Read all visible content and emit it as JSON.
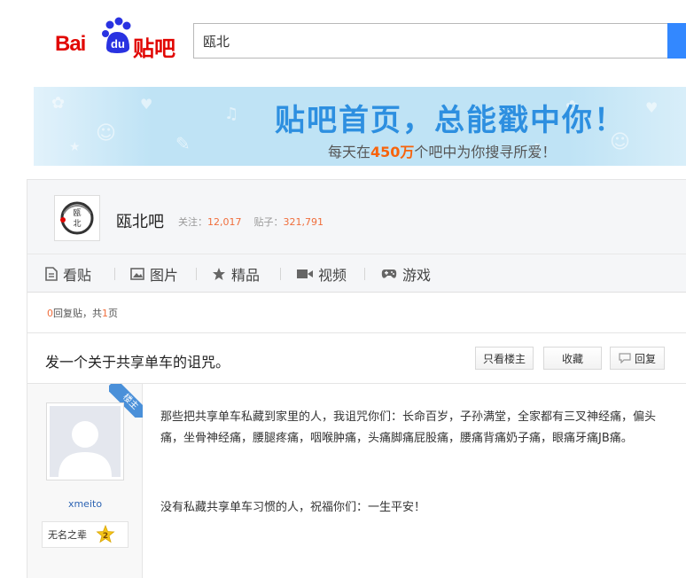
{
  "header": {
    "logo_text_bai": "Bai",
    "logo_text_du": "du",
    "logo_text_tieba": "贴吧",
    "search_value": "瓯北"
  },
  "banner": {
    "title": "贴吧首页，总能戳中你！",
    "sub_prefix": "每天在",
    "sub_number": "450万",
    "sub_suffix": "个吧中为你搜寻所爱！"
  },
  "forum": {
    "avatar_text": "瓯北",
    "name": "瓯北吧",
    "follow_label": "关注：",
    "follow_count": "12,017",
    "posts_label": "贴子：",
    "posts_count": "321,791"
  },
  "nav": {
    "items": [
      {
        "label": "看贴",
        "icon": "document-icon"
      },
      {
        "label": "图片",
        "icon": "image-icon"
      },
      {
        "label": "精品",
        "icon": "star-icon"
      },
      {
        "label": "视频",
        "icon": "video-icon"
      },
      {
        "label": "游戏",
        "icon": "gamepad-icon"
      }
    ]
  },
  "thread": {
    "reply_count": "0",
    "reply_label_mid": "回复贴，共",
    "page_count": "1",
    "reply_label_end": "页",
    "title": "发一个关于共享单车的诅咒。",
    "btn_only_author": "只看楼主",
    "btn_collect": "收藏",
    "btn_reply": "回复"
  },
  "post": {
    "ribbon": "楼主",
    "username": "xmeito",
    "level_title": "无名之辈",
    "level": "2",
    "paragraphs": [
      "那些把共享单车私藏到家里的人，我诅咒你们：长命百岁，子孙满堂，全家都有三叉神经痛，偏头痛，坐骨神经痛，腰腿疼痛，咽喉肿痛，头痛脚痛屁股痛，腰痛背痛奶子痛，眼痛牙痛JB痛。",
      "没有私藏共享单车习惯的人，祝福你们：一生平安！"
    ]
  },
  "colors": {
    "brand_red": "#e10602",
    "accent_blue": "#3388ff",
    "banner_title": "#2d8fe0",
    "highlight_orange": "#f06e3c"
  }
}
